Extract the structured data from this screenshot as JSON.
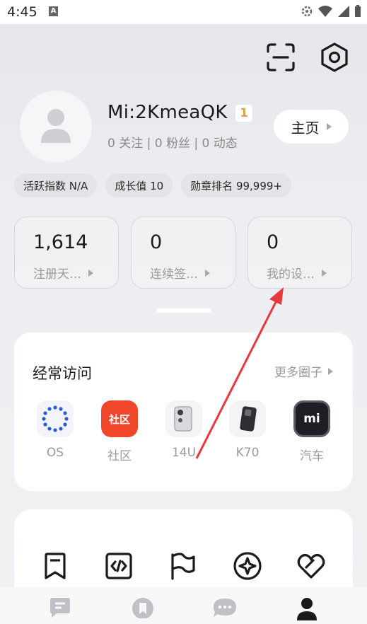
{
  "status_bar": {
    "time": "4:45",
    "notification_letter": "A"
  },
  "profile": {
    "username": "Mi:2KmeaQK",
    "level": "1",
    "follow_line": "0 关注 | 0 粉丝 | 0 动态",
    "homepage_label": "主页"
  },
  "chips": [
    {
      "label": "活跃指数 N/A"
    },
    {
      "label": "成长值 10"
    },
    {
      "label": "勋章排名 99,999+"
    }
  ],
  "stats": [
    {
      "value": "1,614",
      "label": "注册天…"
    },
    {
      "value": "0",
      "label": "连续签…"
    },
    {
      "value": "0",
      "label": "我的设…"
    }
  ],
  "frequent": {
    "title": "经常访问",
    "more_label": "更多圈子",
    "apps": [
      {
        "label": "OS",
        "icon": "os-ring-icon"
      },
      {
        "label": "社区",
        "icon": "community-icon",
        "icon_text": "社区",
        "color": "#f0462a"
      },
      {
        "label": "14U",
        "icon": "phone-14u-icon"
      },
      {
        "label": "K70",
        "icon": "phone-k70-icon"
      },
      {
        "label": "汽车",
        "icon": "mi-car-icon",
        "icon_text": "mi"
      }
    ]
  },
  "tools": [
    {
      "icon": "bookmark-icon"
    },
    {
      "icon": "code-icon"
    },
    {
      "icon": "flag-icon"
    },
    {
      "icon": "compass-star-icon"
    },
    {
      "icon": "heart-icon"
    }
  ],
  "tabbar": [
    {
      "icon": "feed-icon"
    },
    {
      "icon": "bookmark-tab-icon"
    },
    {
      "icon": "chat-icon"
    },
    {
      "icon": "profile-icon",
      "active": true
    }
  ],
  "colors": {
    "accent_red": "#f0462a",
    "annotation_arrow": "#e8383d",
    "level_badge": "#d9a550"
  }
}
